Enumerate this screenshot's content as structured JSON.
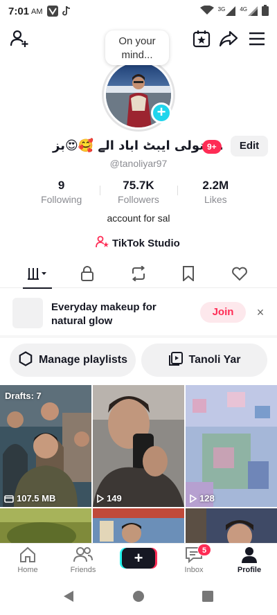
{
  "status_bar": {
    "time": "7:01",
    "ampm": "AM",
    "network_3g": "3G",
    "network_4g": "4G"
  },
  "topbar": {
    "add_friend_icon": "person-plus-icon",
    "bubble_line1": "On your",
    "bubble_line2": "mind..."
  },
  "profile": {
    "display_name": "تنولی ایبٹ اباد الے 🥰😍بز...",
    "notification_badge": "9+",
    "edit_label": "Edit",
    "username": "@tanoliyar97",
    "stats": [
      {
        "value": "9",
        "label": "Following"
      },
      {
        "value": "75.7K",
        "label": "Followers"
      },
      {
        "value": "2.2M",
        "label": "Likes"
      }
    ],
    "bio": "account for sal",
    "studio_label": "TikTok Studio"
  },
  "promo": {
    "line1": "Everyday makeup for",
    "line2": "natural glow",
    "join_label": "Join",
    "close_label": "×"
  },
  "playlists": {
    "manage_label": "Manage playlists",
    "playlist_label": "Tanoli Yar"
  },
  "grid": {
    "drafts_label": "Drafts: 7",
    "drafts_size": "107.5 MB",
    "video2_views": "149",
    "video3_views": "128"
  },
  "bottom_nav": {
    "home": "Home",
    "friends": "Friends",
    "create": "+",
    "inbox": "Inbox",
    "inbox_badge": "5",
    "profile": "Profile"
  },
  "colors": {
    "accent_red": "#fe2c55",
    "accent_cyan": "#20d5ec",
    "text_primary": "#161823",
    "text_secondary": "#8a8b91"
  }
}
